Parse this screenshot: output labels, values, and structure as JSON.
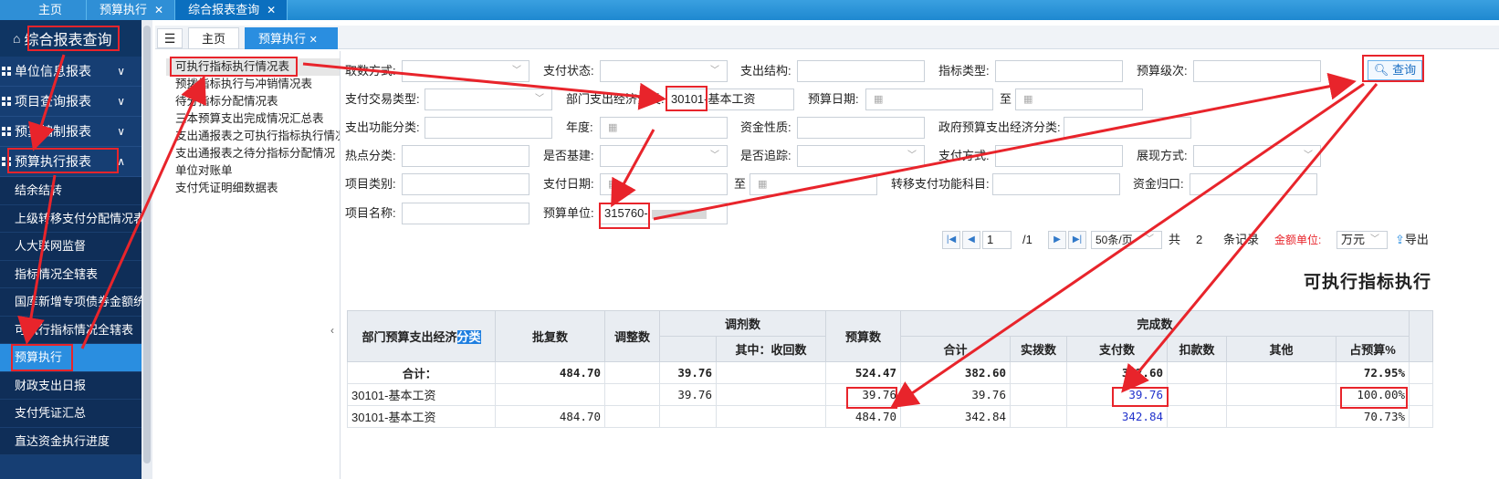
{
  "top_tabs": [
    {
      "label": "主页",
      "closable": false,
      "active": false
    },
    {
      "label": "预算执行",
      "closable": true,
      "active": false
    },
    {
      "label": "综合报表查询",
      "closable": true,
      "active": true
    }
  ],
  "close_glyph": "✕",
  "sidebar": {
    "title": "综合报表查询",
    "sections": [
      {
        "label": "单位信息报表",
        "chevron": "∨"
      },
      {
        "label": "项目查询报表",
        "chevron": "∨"
      },
      {
        "label": "预算编制报表",
        "chevron": "∨"
      },
      {
        "label": "预算执行报表",
        "chevron": "∧"
      }
    ],
    "items": [
      "结余结转",
      "上级转移支付分配情况表",
      "人大联网监督",
      "指标情况全辖表",
      "国库新增专项债券金额统计",
      "可执行指标情况全辖表",
      "预算执行",
      "财政支出日报",
      "支付凭证汇总",
      "直达资金执行进度"
    ]
  },
  "inner_tabs": [
    {
      "label": "主页"
    },
    {
      "label": "预算执行"
    }
  ],
  "report_tree": [
    "可执行指标执行情况表",
    "预拨指标执行与冲销情况表",
    "待分指标分配情况表",
    "三本预算支出完成情况汇总表",
    "支出通报表之可执行指标执行情况",
    "支出通报表之待分指标分配情况",
    "单位对账单",
    "支付凭证明细数据表"
  ],
  "filters": {
    "取数方式": "取数方式:",
    "支付状态": "支付状态:",
    "支出结构": "支出结构:",
    "指标类型": "指标类型:",
    "预算级次": "预算级次:",
    "支付交易类型": "支付交易类型:",
    "部门支出经济分类": "部门支出经济分类:",
    "部门支出经济分类_value": "30101-基本工资",
    "预算日期": "预算日期:",
    "至": "至",
    "支出功能分类": "支出功能分类:",
    "年度": "年度:",
    "资金性质": "资金性质:",
    "政府预算支出经济分类": "政府预算支出经济分类:",
    "热点分类": "热点分类:",
    "是否基建": "是否基建:",
    "是否追踪": "是否追踪:",
    "支付方式": "支付方式:",
    "展现方式": "展现方式:",
    "项目类别": "项目类别:",
    "支付日期": "支付日期:",
    "转移支付功能科目": "转移支付功能科目:",
    "资金归口": "资金归口:",
    "项目名称": "项目名称:",
    "预算单位": "预算单位:",
    "预算单位_value": "315760-"
  },
  "query_button": "查询",
  "pager": {
    "page": "1",
    "total_pages": "/1",
    "page_size": "50条/页",
    "total_prefix": "共",
    "total_count": "2",
    "total_suffix": "条记录",
    "amount_unit_label": "金额单位:",
    "amount_unit": "万元",
    "export": "导出"
  },
  "report_title": "可执行指标执行",
  "table": {
    "headers": {
      "category": "部门预算支出经济",
      "category_highlight": "分类",
      "approved": "批复数",
      "adjust": "调整数",
      "transfer": "调剂数",
      "transfer_recovered": "其中：收回数",
      "budget": "预算数",
      "complete": "完成数",
      "total": "合计",
      "allocated": "实拨数",
      "paid": "支付数",
      "deducted": "扣款数",
      "other": "其他",
      "ratio": "占预算%"
    },
    "rows": [
      {
        "category": "合计：",
        "approved": "484.70",
        "adjust": "",
        "transfer": "39.76",
        "recovered": "",
        "budget": "524.47",
        "total": "382.60",
        "allocated": "",
        "paid": "382.60",
        "deducted": "",
        "other": "",
        "ratio": "72.95%"
      },
      {
        "category": "30101-基本工资",
        "approved": "",
        "adjust": "",
        "transfer": "39.76",
        "recovered": "",
        "budget": "39.76",
        "total": "39.76",
        "allocated": "",
        "paid": "39.76",
        "deducted": "",
        "other": "",
        "ratio": "100.00%"
      },
      {
        "category": "30101-基本工资",
        "approved": "484.70",
        "adjust": "",
        "transfer": "",
        "recovered": "",
        "budget": "484.70",
        "total": "342.84",
        "allocated": "",
        "paid": "342.84",
        "deducted": "",
        "other": "",
        "ratio": "70.73%"
      }
    ]
  },
  "colors": {
    "annotation": "#e8242b",
    "sidebar": "#163e73",
    "accent": "#2a8ee0",
    "link": "#2233cc"
  }
}
